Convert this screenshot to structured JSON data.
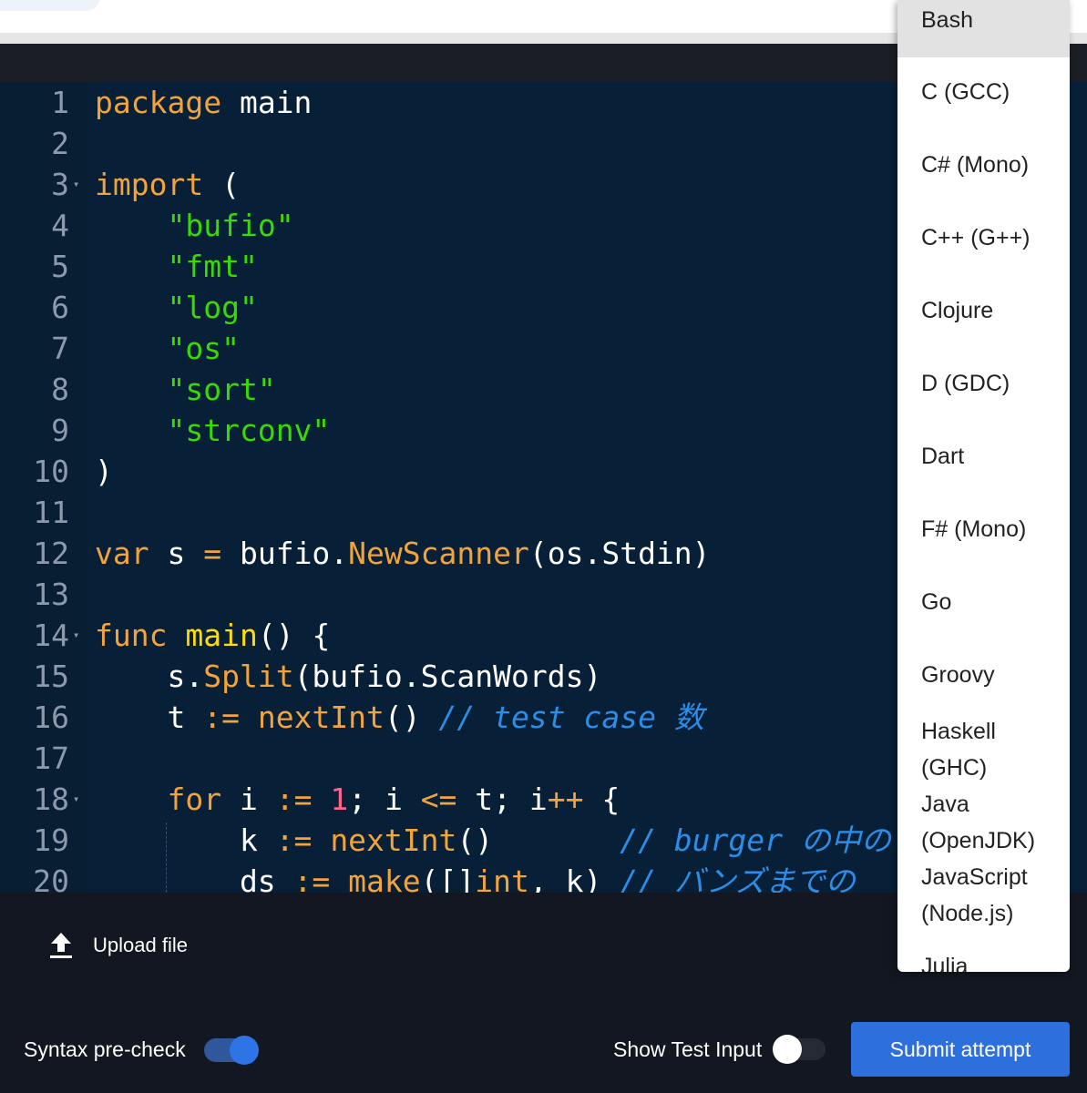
{
  "editor": {
    "lines": [
      {
        "n": "1",
        "fold": "",
        "tokens": [
          {
            "c": "kw",
            "t": "package"
          },
          {
            "c": "",
            "t": " main"
          }
        ]
      },
      {
        "n": "2",
        "fold": "",
        "tokens": []
      },
      {
        "n": "3",
        "fold": "▾",
        "tokens": [
          {
            "c": "kw",
            "t": "import"
          },
          {
            "c": "",
            "t": " ("
          }
        ]
      },
      {
        "n": "4",
        "fold": "",
        "tokens": [
          {
            "c": "",
            "t": "    "
          },
          {
            "c": "str",
            "t": "\"bufio\""
          }
        ]
      },
      {
        "n": "5",
        "fold": "",
        "tokens": [
          {
            "c": "",
            "t": "    "
          },
          {
            "c": "str",
            "t": "\"fmt\""
          }
        ]
      },
      {
        "n": "6",
        "fold": "",
        "tokens": [
          {
            "c": "",
            "t": "    "
          },
          {
            "c": "str",
            "t": "\"log\""
          }
        ]
      },
      {
        "n": "7",
        "fold": "",
        "tokens": [
          {
            "c": "",
            "t": "    "
          },
          {
            "c": "str",
            "t": "\"os\""
          }
        ]
      },
      {
        "n": "8",
        "fold": "",
        "tokens": [
          {
            "c": "",
            "t": "    "
          },
          {
            "c": "str",
            "t": "\"sort\""
          }
        ]
      },
      {
        "n": "9",
        "fold": "",
        "tokens": [
          {
            "c": "",
            "t": "    "
          },
          {
            "c": "str",
            "t": "\"strconv\""
          }
        ]
      },
      {
        "n": "10",
        "fold": "",
        "tokens": [
          {
            "c": "",
            "t": ")"
          }
        ]
      },
      {
        "n": "11",
        "fold": "",
        "tokens": []
      },
      {
        "n": "12",
        "fold": "",
        "tokens": [
          {
            "c": "kw",
            "t": "var"
          },
          {
            "c": "",
            "t": " s "
          },
          {
            "c": "kw",
            "t": "="
          },
          {
            "c": "",
            "t": " bufio."
          },
          {
            "c": "kw",
            "t": "NewScanner"
          },
          {
            "c": "",
            "t": "(os.Stdin)"
          }
        ]
      },
      {
        "n": "13",
        "fold": "",
        "tokens": []
      },
      {
        "n": "14",
        "fold": "▾",
        "tokens": [
          {
            "c": "kw",
            "t": "func"
          },
          {
            "c": "",
            "t": " "
          },
          {
            "c": "fn",
            "t": "main"
          },
          {
            "c": "",
            "t": "() {"
          }
        ]
      },
      {
        "n": "15",
        "fold": "",
        "tokens": [
          {
            "c": "",
            "t": "    s."
          },
          {
            "c": "kw",
            "t": "Split"
          },
          {
            "c": "",
            "t": "(bufio.ScanWords)"
          }
        ]
      },
      {
        "n": "16",
        "fold": "",
        "tokens": [
          {
            "c": "",
            "t": "    t "
          },
          {
            "c": "kw",
            "t": ":="
          },
          {
            "c": "",
            "t": " "
          },
          {
            "c": "kw",
            "t": "nextInt"
          },
          {
            "c": "",
            "t": "() "
          },
          {
            "c": "cm",
            "t": "// test case 数"
          }
        ]
      },
      {
        "n": "17",
        "fold": "",
        "tokens": []
      },
      {
        "n": "18",
        "fold": "▾",
        "tokens": [
          {
            "c": "",
            "t": "    "
          },
          {
            "c": "kw",
            "t": "for"
          },
          {
            "c": "",
            "t": " i "
          },
          {
            "c": "kw",
            "t": ":="
          },
          {
            "c": "",
            "t": " "
          },
          {
            "c": "num",
            "t": "1"
          },
          {
            "c": "",
            "t": "; i "
          },
          {
            "c": "kw",
            "t": "<="
          },
          {
            "c": "",
            "t": " t; i"
          },
          {
            "c": "kw",
            "t": "++"
          },
          {
            "c": "",
            "t": " {"
          }
        ]
      },
      {
        "n": "19",
        "fold": "",
        "tokens": [
          {
            "c": "",
            "t": "        k "
          },
          {
            "c": "kw",
            "t": ":="
          },
          {
            "c": "",
            "t": " "
          },
          {
            "c": "kw",
            "t": "nextInt"
          },
          {
            "c": "",
            "t": "()       "
          },
          {
            "c": "cm",
            "t": "// burger の中の"
          }
        ]
      },
      {
        "n": "20",
        "fold": "",
        "tokens": [
          {
            "c": "",
            "t": "        ds "
          },
          {
            "c": "kw",
            "t": ":="
          },
          {
            "c": "",
            "t": " "
          },
          {
            "c": "kw",
            "t": "make"
          },
          {
            "c": "",
            "t": "([]"
          },
          {
            "c": "kw",
            "t": "int"
          },
          {
            "c": "",
            "t": ", k) "
          },
          {
            "c": "cm",
            "t": "// バンズまでの"
          }
        ]
      }
    ]
  },
  "language_menu": {
    "selected": "Bash",
    "options": [
      "Bash",
      "C (GCC)",
      "C# (Mono)",
      "C++ (G++)",
      "Clojure",
      "D (GDC)",
      "Dart",
      "F# (Mono)",
      "Go",
      "Groovy",
      "Haskell (GHC)",
      "Java (OpenJDK)",
      "JavaScript (Node.js)",
      "Julia"
    ]
  },
  "footer": {
    "upload_label": "Upload file",
    "syntax_precheck_label": "Syntax pre-check",
    "syntax_precheck_on": true,
    "show_test_input_label": "Show Test Input",
    "show_test_input_on": false,
    "submit_label": "Submit attempt"
  },
  "colors": {
    "keyword": "#f2a33a",
    "string": "#3ad900",
    "function": "#ffdd00",
    "number": "#ff628c",
    "comment": "#2c8de8",
    "primary": "#2e6fde"
  }
}
